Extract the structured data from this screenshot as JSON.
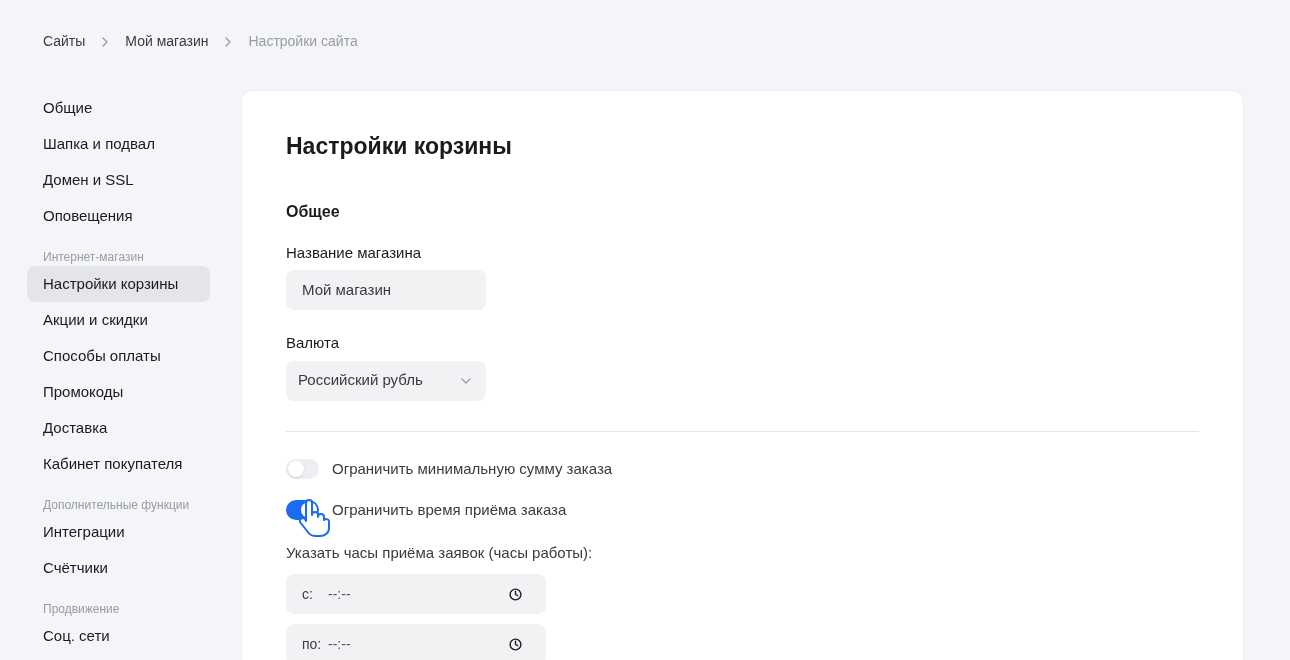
{
  "breadcrumbs": [
    {
      "label": "Сайты",
      "current": false
    },
    {
      "label": "Мой магазин",
      "current": false
    },
    {
      "label": "Настройки сайта",
      "current": true
    }
  ],
  "sidebar": {
    "sections": [
      {
        "items": [
          {
            "label": "Общие",
            "selected": false
          },
          {
            "label": "Шапка и подвал",
            "selected": false
          },
          {
            "label": "Домен и SSL",
            "selected": false
          },
          {
            "label": "Оповещения",
            "selected": false
          }
        ]
      },
      {
        "heading": "Интернет-магазин",
        "items": [
          {
            "label": "Настройки корзины",
            "selected": true
          },
          {
            "label": "Акции и скидки",
            "selected": false
          },
          {
            "label": "Способы оплаты",
            "selected": false
          },
          {
            "label": "Промокоды",
            "selected": false
          },
          {
            "label": "Доставка",
            "selected": false
          },
          {
            "label": "Кабинет покупателя",
            "selected": false
          }
        ]
      },
      {
        "heading": "Дополнительные функции",
        "items": [
          {
            "label": "Интеграции",
            "selected": false
          },
          {
            "label": "Счётчики",
            "selected": false
          }
        ]
      },
      {
        "heading": "Продвижение",
        "items": [
          {
            "label": "Соц. сети",
            "selected": false
          }
        ]
      }
    ]
  },
  "page": {
    "title": "Настройки корзины",
    "section_title": "Общее",
    "store_name": {
      "label": "Название магазина",
      "value": "Мой магазин"
    },
    "currency": {
      "label": "Валюта",
      "value": "Российский рубль"
    },
    "toggles": [
      {
        "label": "Ограничить минимальную сумму заказа",
        "on": false
      },
      {
        "label": "Ограничить время приёма заказа",
        "on": true
      }
    ],
    "hours": {
      "label": "Указать часы приёма заявок (часы работы):",
      "fields": [
        {
          "prefix": "с:",
          "placeholder": "--:--"
        },
        {
          "prefix": "по:",
          "placeholder": "--:--"
        }
      ]
    }
  }
}
